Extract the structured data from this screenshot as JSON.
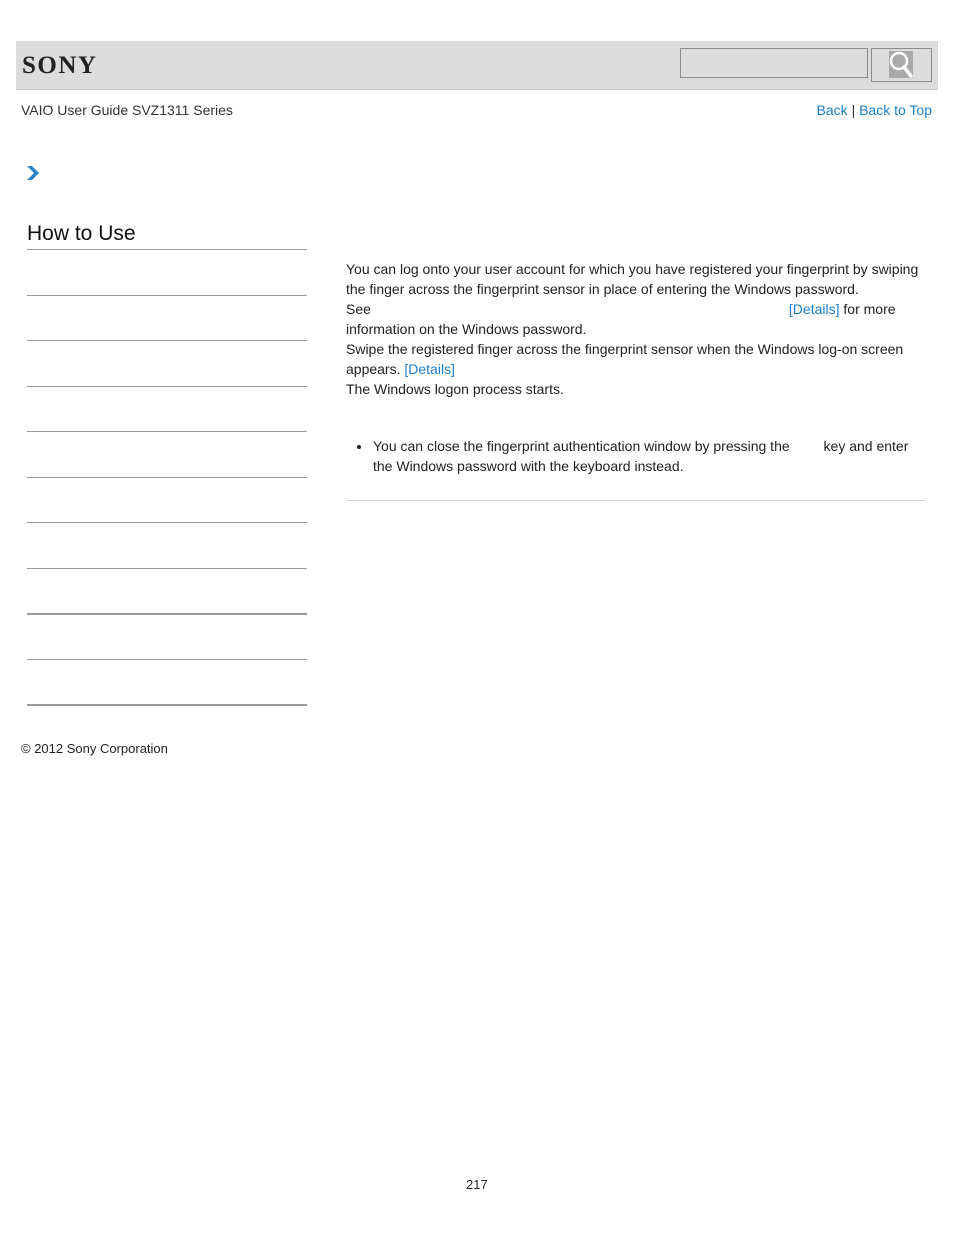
{
  "header": {
    "brand": "SONY",
    "search": {
      "value": "",
      "placeholder": ""
    },
    "search_icon": "magnifier-icon"
  },
  "guide_title": "VAIO User Guide SVZ1311 Series",
  "topnav": {
    "back": "Back",
    "separator": "|",
    "back_to_top": "Back to Top"
  },
  "breadcrumb_icon": "chevron-right-icon",
  "sidebar": {
    "title": "How to Use",
    "item_count": 10
  },
  "content": {
    "intro_line1": "You can log onto your user account for which you have registered your fingerprint by swiping the finger across the fingerprint sensor in place of entering the Windows password.",
    "see_label": "See",
    "details_link_1": "[Details]",
    "intro_line2_tail": "for more information on the Windows password.",
    "step_text": "Swipe the registered finger across the fingerprint sensor when the Windows log-on screen appears.",
    "details_link_2": "[Details]",
    "step_result": "The Windows logon process starts.",
    "note_part1": "You can close the fingerprint authentication window by pressing the",
    "note_part2": "key and enter the Windows password with the keyboard instead."
  },
  "footer": {
    "copyright": "© 2012 Sony Corporation",
    "page_number": "217"
  },
  "colors": {
    "link": "#1a7ec8",
    "header_bg": "#dcdcdc",
    "rule": "#9a9a9a"
  }
}
